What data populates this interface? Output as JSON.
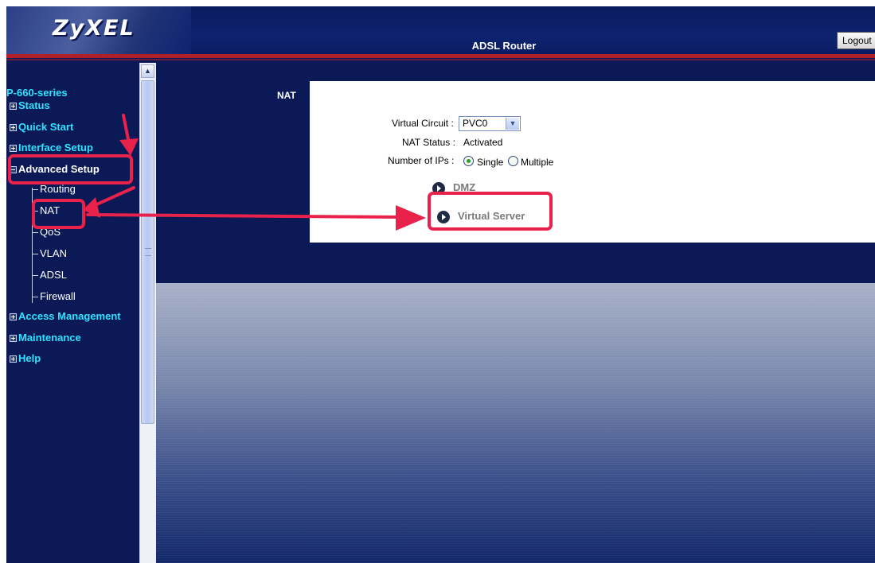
{
  "header": {
    "logo_text": "ZyXEL",
    "title": "ADSL Router",
    "logout_label": "Logout"
  },
  "sidebar": {
    "model": "P-660-series",
    "items": [
      {
        "label": "Status",
        "state": "collapsed"
      },
      {
        "label": "Quick Start",
        "state": "collapsed"
      },
      {
        "label": "Interface Setup",
        "state": "collapsed"
      },
      {
        "label": "Advanced Setup",
        "state": "expanded"
      },
      {
        "label": "Access Management",
        "state": "collapsed"
      },
      {
        "label": "Maintenance",
        "state": "collapsed"
      },
      {
        "label": "Help",
        "state": "collapsed"
      }
    ],
    "sub_items": [
      "Routing",
      "NAT",
      "QoS",
      "VLAN",
      "ADSL",
      "Firewall"
    ]
  },
  "main": {
    "section_title": "NAT",
    "virtual_circuit_label": "Virtual Circuit :",
    "virtual_circuit_value": "PVC0",
    "nat_status_label": "NAT Status :",
    "nat_status_value": "Activated",
    "num_ips_label": "Number of IPs :",
    "num_ips_options": [
      "Single",
      "Multiple"
    ],
    "num_ips_selected": "Single",
    "links": [
      "DMZ",
      "Virtual Server"
    ]
  },
  "colors": {
    "background": "#0b1a57",
    "nav_text": "#2ee3ff",
    "annotation": "#e8224a",
    "header_redline": "#b0202b"
  }
}
